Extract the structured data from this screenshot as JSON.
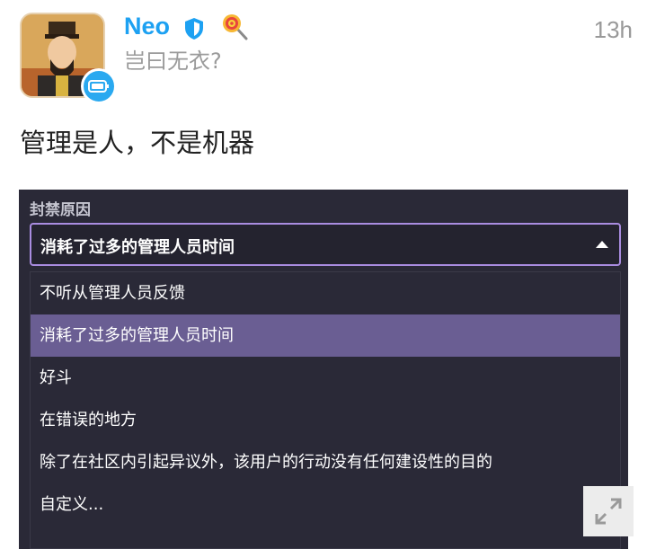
{
  "post": {
    "username": "Neo",
    "status": "岂曰无衣?",
    "time": "13h",
    "text": "管理是人，不是机器"
  },
  "icons": {
    "verified": "shield-icon",
    "lollipop": "lollipop-icon",
    "badge": "battery-icon",
    "expand": "expand-icon"
  },
  "colors": {
    "username": "#1da1f2",
    "panel_bg": "#2a2937",
    "selected_bg": "#6a5e93",
    "focus_border": "#a98ce0"
  },
  "ban_panel": {
    "label": "封禁原因",
    "selected_value": "消耗了过多的管理人员时间",
    "options": [
      "不听从管理人员反馈",
      "消耗了过多的管理人员时间",
      "好斗",
      "在错误的地方",
      "除了在社区内引起异议外，该用户的行动没有任何建设性的目的",
      "自定义..."
    ],
    "selected_index": 1
  }
}
